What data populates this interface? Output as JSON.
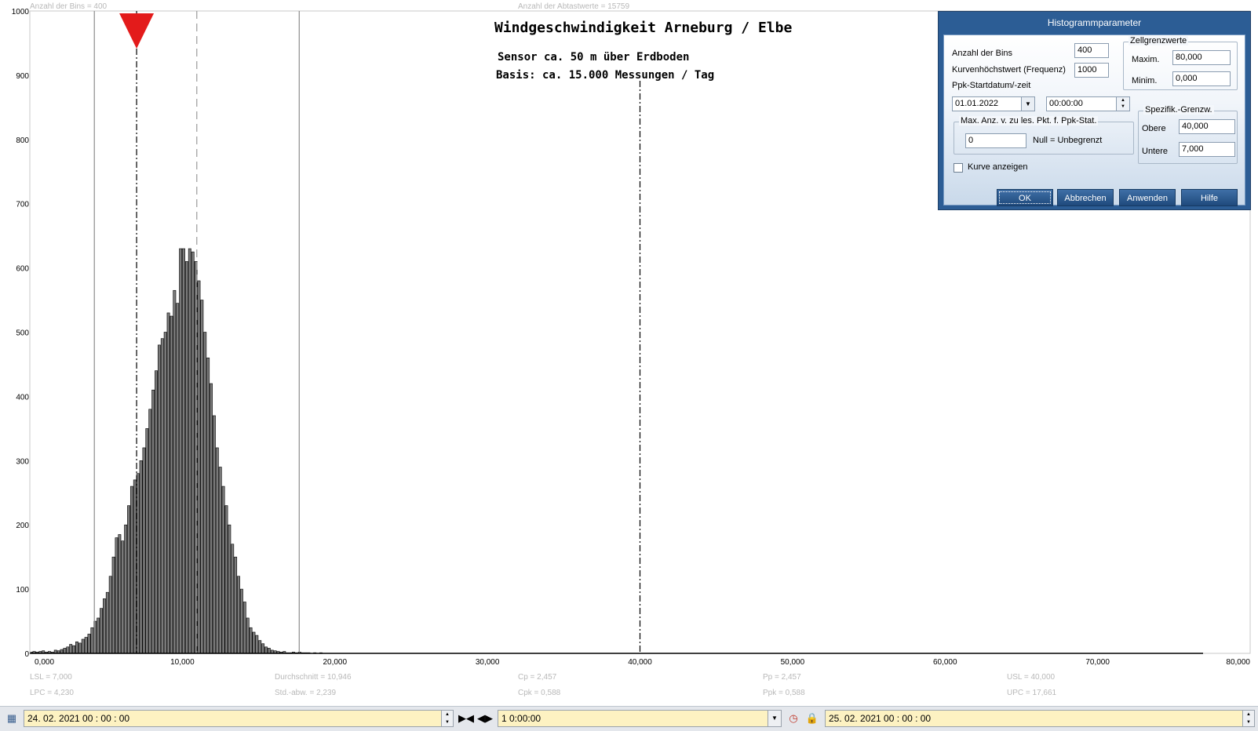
{
  "chart_data": {
    "type": "bar",
    "title": "Windgeschwindigkeit  Arneburg / Elbe",
    "subtitle_1": "Sensor ca. 50 m über Erdboden",
    "subtitle_2": "Basis:  ca.  15.000  Messungen  /  Tag",
    "xlim": [
      0,
      80
    ],
    "ylim": [
      0,
      1000
    ],
    "x_ticks": [
      "0,000",
      "10,000",
      "20,000",
      "30,000",
      "40,000",
      "50,000",
      "60,000",
      "70,000",
      "80,000"
    ],
    "y_ticks": [
      "0",
      "100",
      "200",
      "300",
      "400",
      "500",
      "600",
      "700",
      "800",
      "900",
      "1000"
    ],
    "bin_width": 0.2,
    "bin_start": 0.0,
    "values": [
      2,
      3,
      2,
      3,
      4,
      2,
      3,
      2,
      5,
      4,
      6,
      8,
      10,
      14,
      12,
      18,
      16,
      22,
      25,
      30,
      40,
      50,
      55,
      70,
      85,
      95,
      120,
      150,
      180,
      185,
      175,
      200,
      230,
      260,
      270,
      280,
      300,
      320,
      350,
      380,
      410,
      440,
      480,
      490,
      500,
      530,
      525,
      565,
      545,
      630,
      630,
      610,
      630,
      625,
      610,
      580,
      550,
      500,
      460,
      420,
      370,
      320,
      290,
      260,
      230,
      200,
      170,
      150,
      120,
      100,
      80,
      55,
      40,
      33,
      28,
      20,
      15,
      10,
      8,
      5,
      4,
      3,
      2,
      3,
      1,
      1,
      2,
      1,
      2,
      1,
      1,
      1,
      0,
      1,
      0,
      1
    ],
    "vlines": [
      {
        "x": 4.23,
        "style": "solid",
        "color": "#8c8c8c"
      },
      {
        "x": 7.0,
        "style": "dashdot",
        "color": "#000000"
      },
      {
        "x": 10.946,
        "style": "dashed",
        "color": "#9a9a9a"
      },
      {
        "x": 17.661,
        "style": "solid",
        "color": "#8c8c8c"
      },
      {
        "x": 40.0,
        "style": "dashdot",
        "color": "#000000"
      }
    ],
    "marker_x": 7.0,
    "marker_color": "#e31b1b",
    "top_labels": {
      "bins": "Anzahl der Bins =   400",
      "samples": "Anzahl der Abtastwerte = 15759"
    },
    "stats": [
      {
        "col": 0,
        "row": 0,
        "text": "LSL = 7,000"
      },
      {
        "col": 0,
        "row": 1,
        "text": "LPC = 4,230"
      },
      {
        "col": 1,
        "row": 0,
        "text": "Durchschnitt  = 10,946"
      },
      {
        "col": 1,
        "row": 1,
        "text": "Std.-abw.  = 2,239"
      },
      {
        "col": 2,
        "row": 0,
        "text": "Cp   = 2,457"
      },
      {
        "col": 2,
        "row": 1,
        "text": "Cpk = 0,588"
      },
      {
        "col": 3,
        "row": 0,
        "text": "Pp   = 2,457"
      },
      {
        "col": 3,
        "row": 1,
        "text": "Ppk = 0,588"
      },
      {
        "col": 4,
        "row": 0,
        "text": "USL = 40,000"
      },
      {
        "col": 4,
        "row": 1,
        "text": "UPC = 17,661"
      }
    ]
  },
  "dialog": {
    "title": "Histogrammparameter",
    "bins_label": "Anzahl der Bins",
    "bins_value": "400",
    "curve_max_label": "Kurvenhöchstwert (Frequenz)",
    "curve_max_value": "1000",
    "ppk_start_label": "Ppk-Startdatum/-zeit",
    "ppk_date": "01.01.2022",
    "ppk_time": "00:00:00",
    "max_pts_group": "Max. Anz. v. zu les. Pkt. f. Ppk-Stat.",
    "max_pts_value": "0",
    "max_pts_hint": "Null = Unbegrenzt",
    "show_curve_label": "Kurve anzeigen",
    "cell_limits_group": "Zellgrenzwerte",
    "cell_max_label": "Maxim.",
    "cell_max_value": "80,000",
    "cell_min_label": "Minim.",
    "cell_min_value": "0,000",
    "spec_group": "Spezifik.-Grenzw.",
    "spec_upper_label": "Obere",
    "spec_upper_value": "40,000",
    "spec_lower_label": "Untere",
    "spec_lower_value": "7,000",
    "buttons": {
      "ok": "OK",
      "cancel": "Abbrechen",
      "apply": "Anwenden",
      "help": "Hilfe"
    }
  },
  "bottom_bar": {
    "start": "24. 02. 2021    00 : 00 : 00",
    "interval": "1 0:00:00",
    "end": "25. 02. 2021    00 : 00 : 00",
    "icons": [
      "calendar-icon",
      "collapse-arrows-icon",
      "expand-arrows-icon",
      "clock-icon",
      "lock-icon"
    ]
  }
}
